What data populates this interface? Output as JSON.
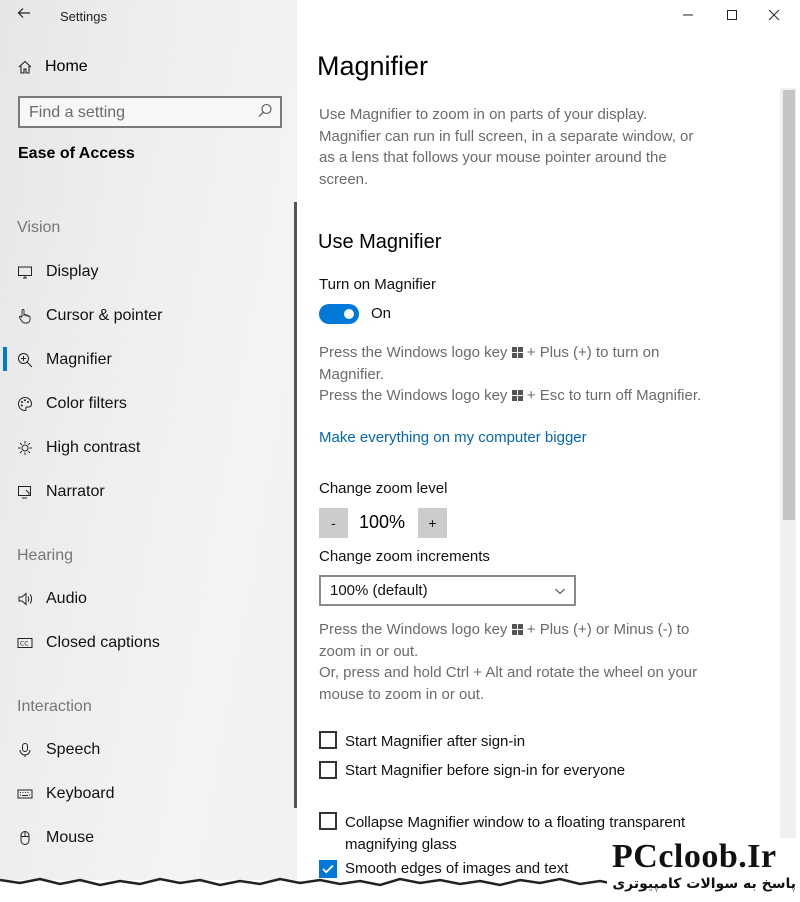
{
  "window": {
    "app_title": "Settings"
  },
  "sidebar": {
    "home_label": "Home",
    "search_placeholder": "Find a setting",
    "section": "Ease of Access",
    "groups": {
      "vision": "Vision",
      "hearing": "Hearing",
      "interaction": "Interaction"
    },
    "items": {
      "display": "Display",
      "cursor": "Cursor & pointer",
      "magnifier": "Magnifier",
      "color_filters": "Color filters",
      "high_contrast": "High contrast",
      "narrator": "Narrator",
      "audio": "Audio",
      "closed_captions": "Closed captions",
      "speech": "Speech",
      "keyboard": "Keyboard",
      "mouse": "Mouse"
    },
    "selected_item": "Magnifier"
  },
  "main": {
    "title": "Magnifier",
    "description": [
      "Use Magnifier to zoom in on parts of your display.",
      "Magnifier can run in full screen, in a separate window, or",
      "as a lens that follows your mouse pointer around the",
      "screen."
    ],
    "use_heading": "Use Magnifier",
    "turn_on_label": "Turn on Magnifier",
    "toggle_state": "On",
    "hotkey_help": {
      "line1_a": "Press the Windows logo key",
      "line1_b": "+ Plus (+) to turn on",
      "line2": "Magnifier.",
      "line3_a": "Press the Windows logo key",
      "line3_b": "+ Esc to turn off Magnifier."
    },
    "bigger_link": "Make everything on my computer bigger",
    "zoom_level_label": "Change zoom level",
    "zoom_minus": "-",
    "zoom_value": "100%",
    "zoom_plus": "+",
    "increments_label": "Change zoom increments",
    "increments_value": "100% (default)",
    "zoom_help": {
      "line1_a": "Press the Windows logo key",
      "line1_b": "+ Plus (+) or Minus (-) to",
      "line2": "zoom in or out.",
      "line3": "Or, press and hold Ctrl + Alt and rotate the wheel on your",
      "line4": "mouse to zoom in or out."
    },
    "checkboxes": {
      "after_signin": {
        "label": "Start Magnifier after sign-in",
        "checked": false
      },
      "before_signin": {
        "label": "Start Magnifier before sign-in for everyone",
        "checked": false
      },
      "collapse": {
        "label_1": "Collapse Magnifier window to a floating transparent",
        "label_2": "magnifying glass",
        "checked": false
      },
      "smooth": {
        "label": "Smooth edges of images and text",
        "checked": true
      }
    }
  },
  "watermark": {
    "logo": "PCcloob.Ir",
    "tagline": "پاسخ به سوالات کامپیوتری"
  },
  "colors": {
    "accent": "#0078d7",
    "link": "#0067b8"
  }
}
